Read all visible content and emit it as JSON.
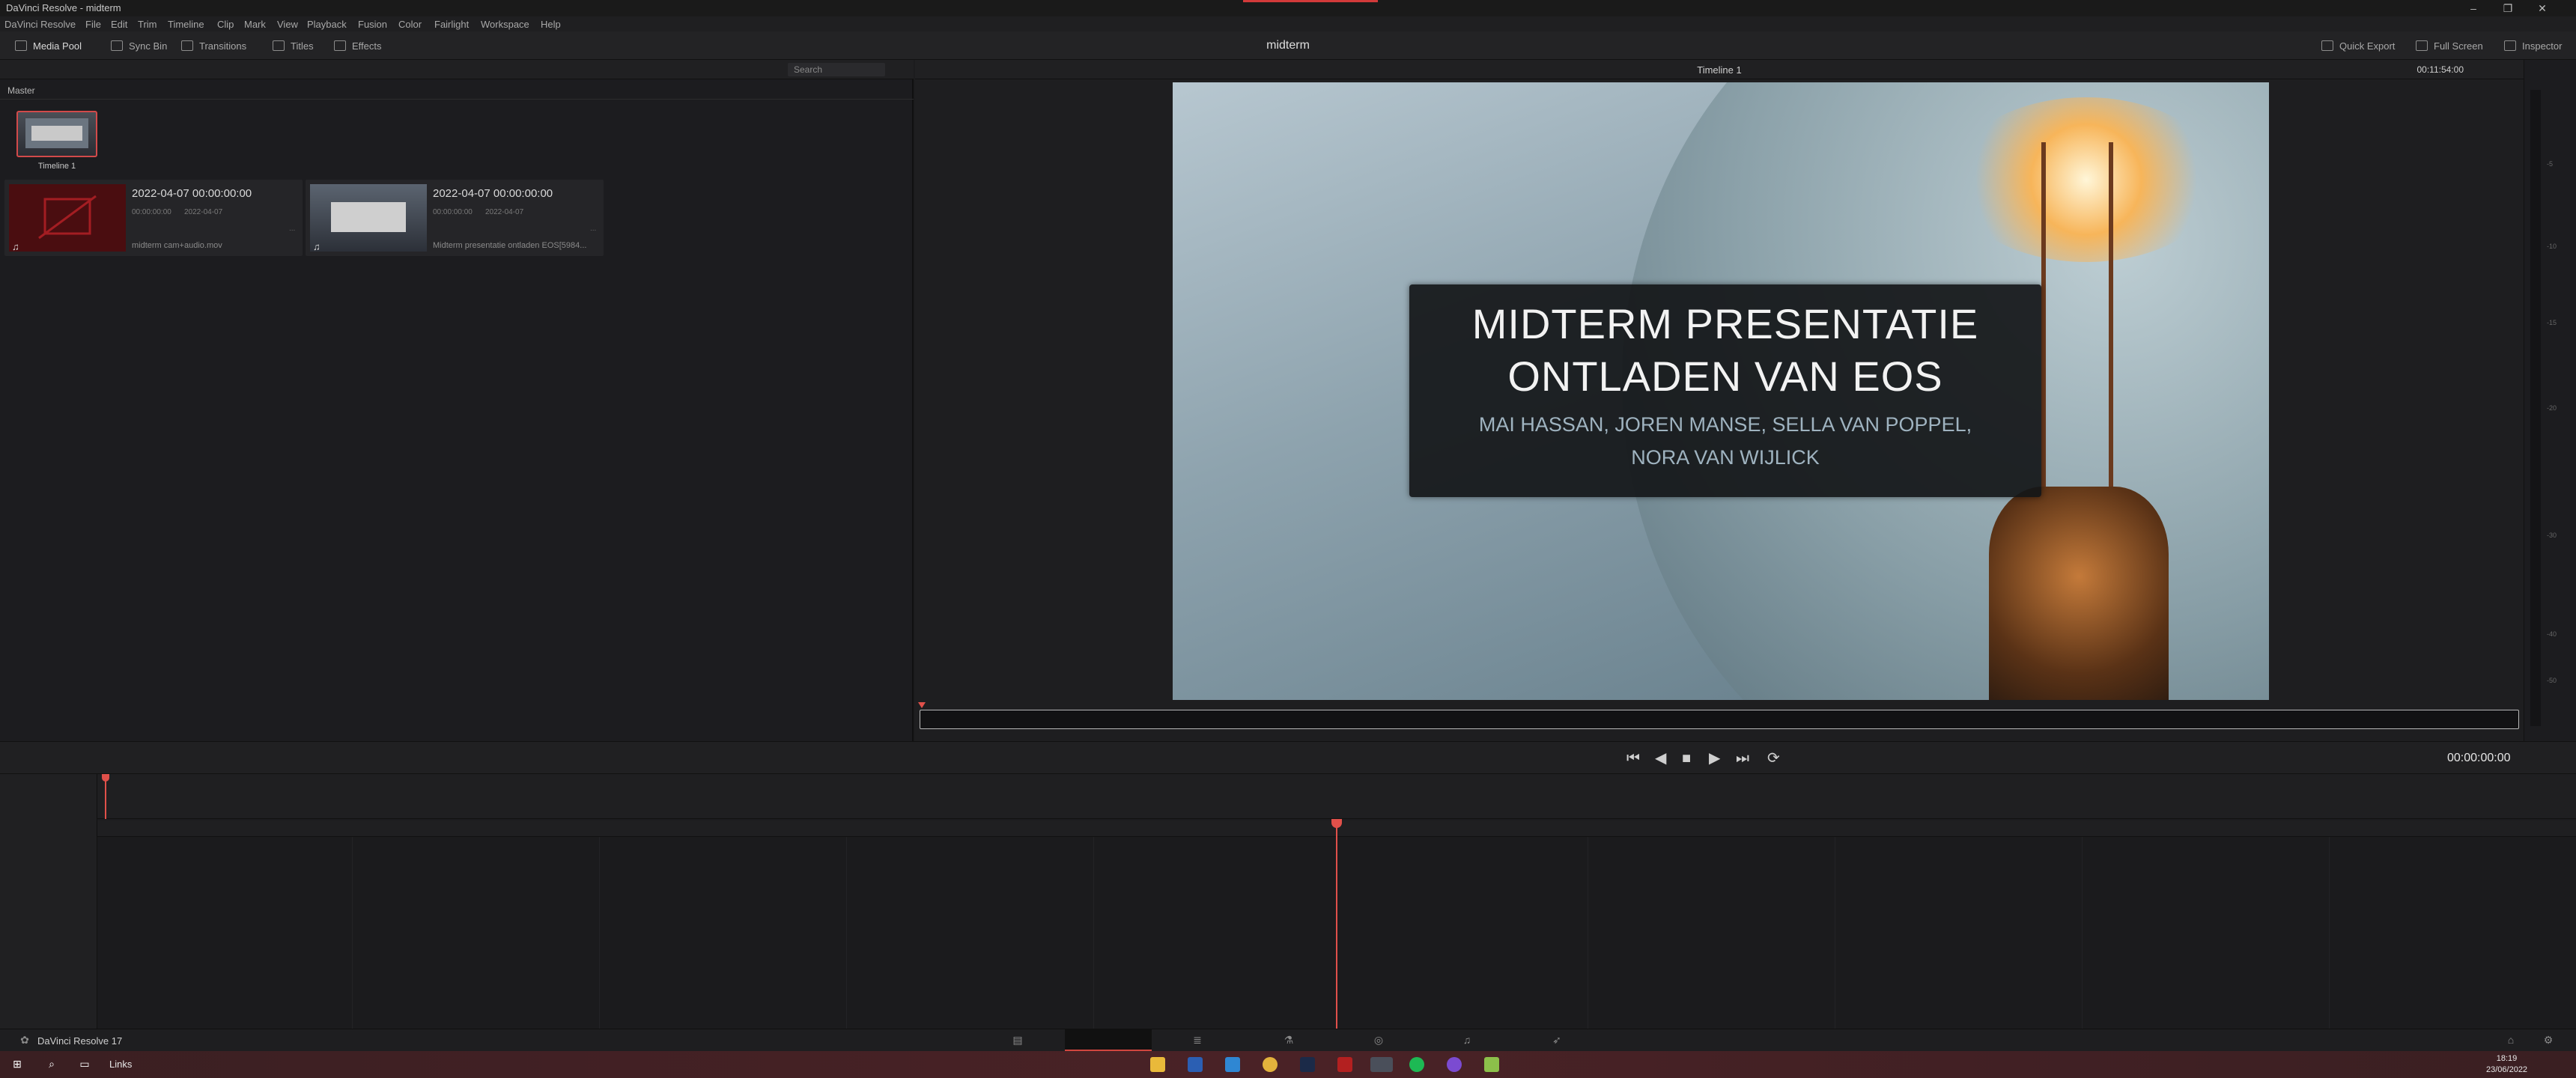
{
  "window": {
    "title": "DaVinci Resolve - midterm"
  },
  "menu": [
    "DaVinci Resolve",
    "File",
    "Edit",
    "Trim",
    "Timeline",
    "Clip",
    "Mark",
    "View",
    "Playback",
    "Fusion",
    "Color",
    "Fairlight",
    "Workspace",
    "Help"
  ],
  "toolbar": {
    "media_pool": "Media Pool",
    "sync_bin": "Sync Bin",
    "transitions": "Transitions",
    "titles": "Titles",
    "effects": "Effects",
    "project_name": "midterm",
    "quick_export": "Quick Export",
    "full_screen": "Full Screen",
    "inspector": "Inspector"
  },
  "media_pool": {
    "search_placeholder": "Search",
    "bin": "Master",
    "timeline_item": "Timeline 1",
    "clips": [
      {
        "date": "2022-04-07  00:00:00:00",
        "meta_a": "00:00:00:00",
        "meta_b": "2022-04-07",
        "dash": "...",
        "filename": "midterm cam+audio.mov"
      },
      {
        "date": "2022-04-07  00:00:00:00",
        "meta_a": "00:00:00:00",
        "meta_b": "2022-04-07",
        "dash": "...",
        "filename": "Midterm presentatie ontladen EOS[5984..."
      }
    ]
  },
  "viewer": {
    "title": "Timeline 1",
    "timecode": "00:11:54:00",
    "slide": {
      "line1": "MIDTERM PRESENTATIE",
      "line2": "ONTLADEN VAN EOS",
      "sub1": "MAI HASSAN, JOREN MANSE, SELLA VAN POPPEL,",
      "sub2": "NORA VAN WIJLICK"
    }
  },
  "meters": [
    "-5",
    "-10",
    "-15",
    "-20",
    "-30",
    "-40",
    "-50"
  ],
  "transport": {
    "timecode": "00:00:00:00"
  },
  "pagebar": {
    "app_version": "DaVinci Resolve 17"
  },
  "taskbar": {
    "search_text": "Links",
    "time": "18:19",
    "date": "23/06/2022"
  },
  "colors": {
    "accent_red": "#d2463f",
    "bg": "#1c1c1e"
  }
}
